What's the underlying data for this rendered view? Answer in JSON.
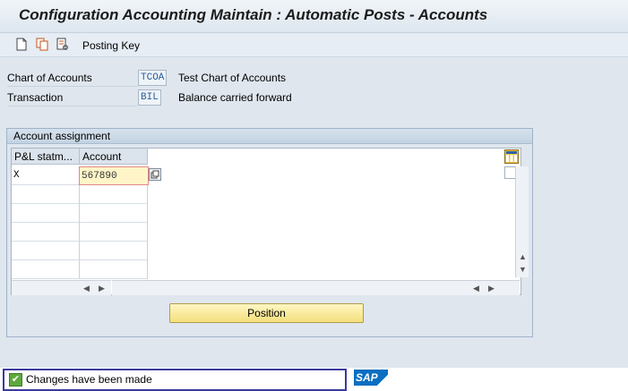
{
  "window": {
    "title": "Configuration Accounting Maintain : Automatic Posts - Accounts"
  },
  "toolbar": {
    "icons": [
      "new-entries-icon",
      "copy-as-icon",
      "delete-icon"
    ],
    "posting_key_label": "Posting Key"
  },
  "header": {
    "chart_of_accounts_label": "Chart of Accounts",
    "chart_of_accounts_value": "TCOA",
    "chart_of_accounts_desc": "Test Chart of Accounts",
    "transaction_label": "Transaction",
    "transaction_value": "BIL",
    "transaction_desc": "Balance carried forward"
  },
  "account_assignment": {
    "title": "Account assignment",
    "columns": [
      "P&L statm...",
      "Account"
    ],
    "rows": [
      {
        "pl": "X",
        "account": "567890"
      }
    ],
    "position_button": "Position"
  },
  "status": {
    "message": "Changes have been made",
    "type": "success"
  },
  "colors": {
    "accent_yellow": "#f4df7b",
    "status_border": "#3a3a9e",
    "sap_blue": "#0a6fc2"
  },
  "logo_text": "SAP"
}
